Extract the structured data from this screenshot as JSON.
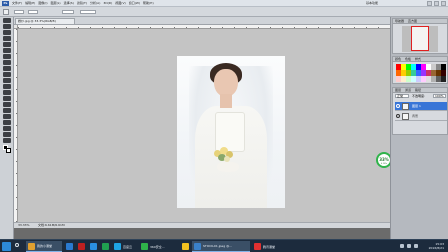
{
  "app": {
    "logo": "Ps",
    "menus": [
      "文件(F)",
      "编辑(E)",
      "图像(I)",
      "图层(L)",
      "选择(S)",
      "滤镜(T)",
      "分析(A)",
      "3D(D)",
      "视图(V)",
      "窗口(W)",
      "帮助(H)"
    ],
    "workspace": "基本功能"
  },
  "document": {
    "tab_title": "婚纱.jpg @ 33.3%(RGB/8)",
    "zoom_status": "33.33%",
    "doc_status": "文档:6.61M/6.61M"
  },
  "zoom_badge": {
    "value": "33%",
    "sub": "0.1K/s"
  },
  "panels": {
    "navigator": {
      "tabs": [
        "导航器",
        "直方图"
      ]
    },
    "color": {
      "tabs": [
        "颜色",
        "色板",
        "样式"
      ]
    },
    "layers": {
      "tabs": [
        "图层",
        "通道",
        "路径"
      ],
      "blend_mode": "正常",
      "opacity_label": "不透明度:",
      "opacity": "100%",
      "items": [
        {
          "name": "图层 1",
          "selected": true
        },
        {
          "name": "背景",
          "selected": false
        }
      ]
    }
  },
  "taskbar": {
    "tasks": [
      {
        "label": "我的小课堂",
        "color": "#e0a030",
        "active": true
      },
      {
        "label": "",
        "color": "#2a7ad0",
        "active": false
      },
      {
        "label": "",
        "color": "#c02020",
        "active": false
      },
      {
        "label": "",
        "color": "#2a8fe0",
        "active": false
      },
      {
        "label": "",
        "color": "#20a050",
        "active": false
      },
      {
        "label": "百度云",
        "color": "#1ea5e5",
        "active": false
      },
      {
        "label": "360安全...",
        "color": "#2fb34a",
        "active": false
      },
      {
        "label": "",
        "color": "#f0c020",
        "active": false
      },
      {
        "label": "STOCK-01.jpeg @...",
        "color": "#3a80c8",
        "active": true
      },
      {
        "label": "腾讯课堂",
        "color": "#e03030",
        "active": false
      }
    ],
    "time": "15:03",
    "date": "2016/8/21"
  },
  "colors": {
    "accent": "#2d8ad8",
    "zoom_green": "#2fb34a",
    "layer_selected": "#3875d7"
  }
}
